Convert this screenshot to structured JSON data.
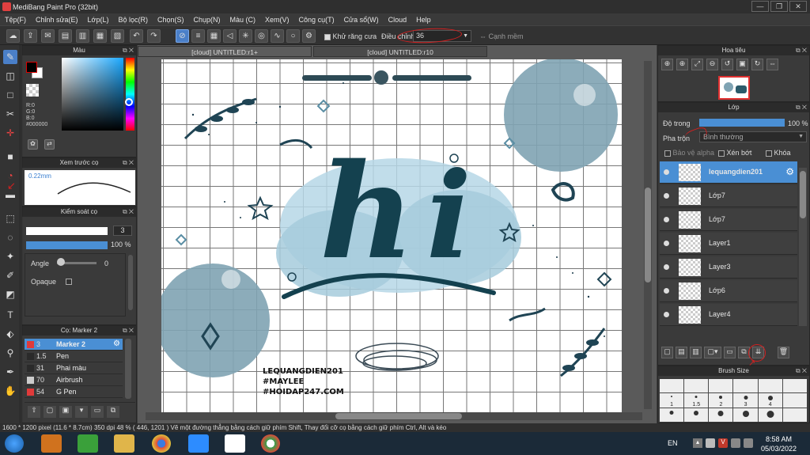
{
  "window": {
    "title": "MediBang Paint Pro (32bit)",
    "controls": [
      "—",
      "❐",
      "✕"
    ]
  },
  "menu": [
    "Tệp(F)",
    "Chỉnh sửa(E)",
    "Lớp(L)",
    "Bộ lọc(R)",
    "Chọn(S)",
    "Chụp(N)",
    "Màu (C)",
    "Xem(V)",
    "Công cụ(T)",
    "Cửa sổ(W)",
    "Cloud",
    "Help"
  ],
  "toolbar": {
    "antialias_label": "Khử răng cưa",
    "adjust_label": "Điều chỉnh",
    "adjust_value": "36",
    "edge_label": "Cạnh mềm"
  },
  "color_panel": {
    "title": "Màu",
    "r": "R:0",
    "g": "G:0",
    "b": "B:0",
    "hex": "#000000",
    "fg": "#000000",
    "bg": "#ffffff"
  },
  "brush_preview": {
    "title": "Xem trước cọ",
    "size": "0.22mm"
  },
  "brush_control": {
    "title": "Kiểm soát cọ",
    "size_value": "3",
    "opacity_value": "100 %",
    "angle_label": "Angle",
    "angle_value": "0",
    "opaque_label": "Opaque"
  },
  "brush_list": {
    "title": "Cọ: Marker 2",
    "items": [
      {
        "size": "3",
        "name": "Marker 2",
        "swatch": "#e03a3a"
      },
      {
        "size": "1.5",
        "name": "Pen",
        "swatch": "#2a2a2a"
      },
      {
        "size": "31",
        "name": "Phai màu",
        "swatch": "#2a2a2a"
      },
      {
        "size": "70",
        "name": "Airbrush",
        "swatch": "#cccccc"
      },
      {
        "size": "54",
        "name": "G Pen",
        "swatch": "#e03a3a"
      }
    ]
  },
  "tabs": [
    "[cloud] UNTITLED:r1+",
    "[cloud] UNTITLED:r10"
  ],
  "canvas_text": {
    "h": "h",
    "i": "i",
    "signature": [
      "LEQUANGDIEN201",
      "#MAYLEE",
      "#HOIDAP247.COM"
    ]
  },
  "navigator": {
    "title": "Hoa tiêu"
  },
  "layer_panel": {
    "title": "Lớp",
    "opacity_label": "Độ trong",
    "opacity_value": "100 %",
    "blend_label": "Pha trộn",
    "blend_value": "Bình thường",
    "protect_alpha": "Bảo vệ alpha",
    "clipping": "Xén bớt",
    "lock": "Khóa",
    "layers": [
      {
        "name": "lequangdien201",
        "selected": true
      },
      {
        "name": "Lớp7",
        "selected": false
      },
      {
        "name": "Lớp7",
        "selected": false
      },
      {
        "name": "Layer1",
        "selected": false
      },
      {
        "name": "Layer3",
        "selected": false
      },
      {
        "name": "Lớp6",
        "selected": false
      },
      {
        "name": "Layer4",
        "selected": false
      }
    ]
  },
  "brush_size_panel": {
    "title": "Brush Size",
    "values": [
      "1",
      "1.5",
      "2",
      "3",
      "4"
    ]
  },
  "status": {
    "dimensions": "1600 * 1200 pixel",
    "physical": "(11.6 * 8.7cm)",
    "dpi": "350 dpi",
    "zoom": "48 %",
    "coords": "( 446, 1201 )",
    "hint": "Vẽ một đường thẳng bằng cách giữ phím Shift, Thay đổi cỡ cọ bằng cách giữ phím Ctrl, Alt và kéo"
  },
  "taskbar": {
    "lang": "EN",
    "time": "8:58 AM",
    "date": "05/03/2022"
  },
  "colors": {
    "accent": "#4a8fd4",
    "panel": "#3a3a3a",
    "annotation": "#d42020"
  }
}
